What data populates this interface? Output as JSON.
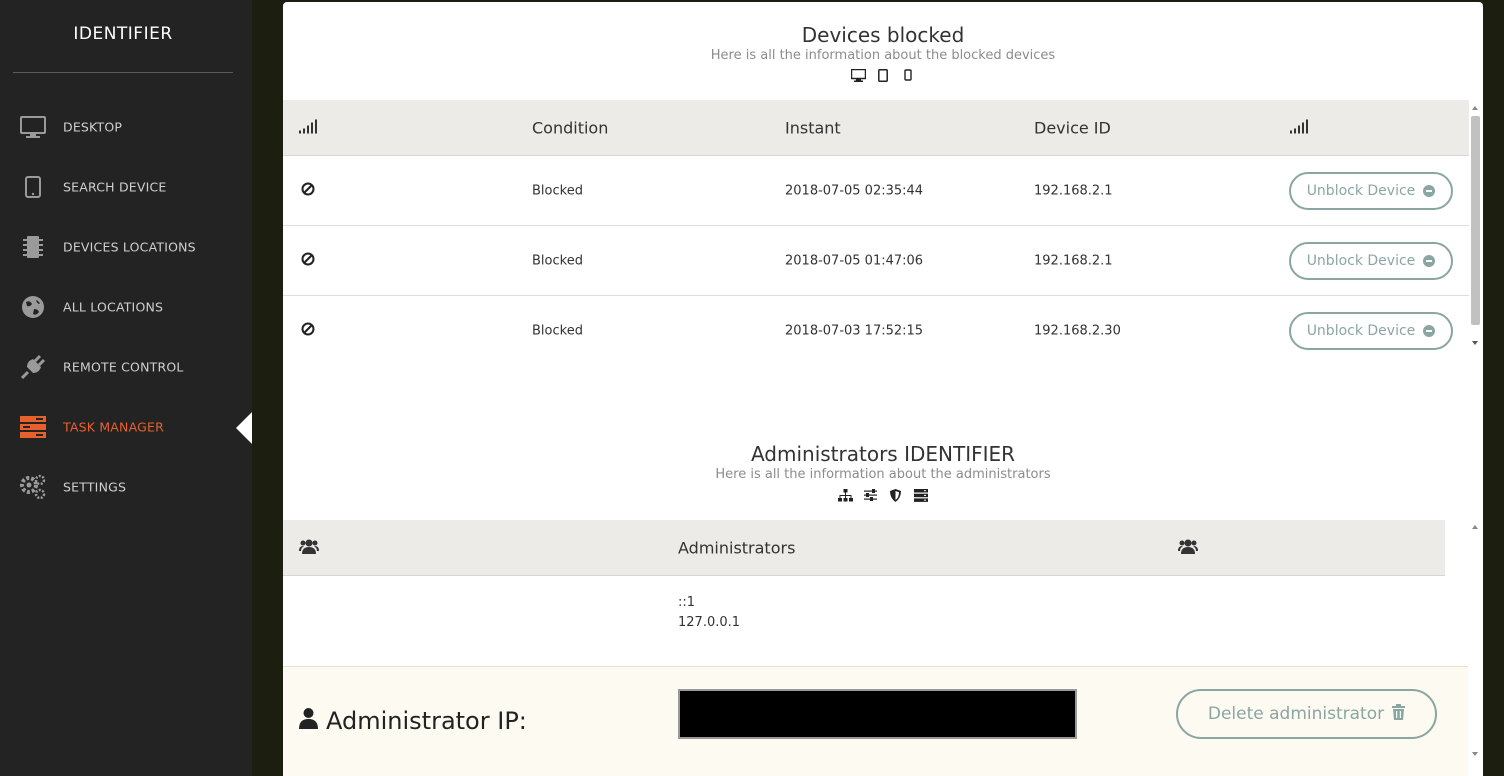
{
  "app": {
    "brand": "IDENTIFIER"
  },
  "sidebar": {
    "items": [
      {
        "label": "DESKTOP",
        "icon": "monitor-icon"
      },
      {
        "label": "SEARCH DEVICE",
        "icon": "tablet-icon"
      },
      {
        "label": "DEVICES LOCATIONS",
        "icon": "chip-icon"
      },
      {
        "label": "ALL LOCATIONS",
        "icon": "globe-icon"
      },
      {
        "label": "REMOTE CONTROL",
        "icon": "plug-icon"
      },
      {
        "label": "TASK MANAGER",
        "icon": "tasks-icon",
        "active": true
      },
      {
        "label": "SETTINGS",
        "icon": "gears-icon"
      }
    ],
    "active_color": "#e8602c"
  },
  "blocked": {
    "title": "Devices blocked",
    "subtitle": "Here is all the information about the blocked devices",
    "icons": [
      "desktop-icon",
      "tablet-icon",
      "mobile-icon"
    ],
    "headers": {
      "signal": "signal-icon",
      "condition": "Condition",
      "instant": "Instant",
      "device_id": "Device ID",
      "signal_end": "signal-icon"
    },
    "rows": [
      {
        "condition": "Blocked",
        "instant": "2018-07-05 02:35:44",
        "device_id": "192.168.2.1",
        "action": "Unblock Device"
      },
      {
        "condition": "Blocked",
        "instant": "2018-07-05 01:47:06",
        "device_id": "192.168.2.1",
        "action": "Unblock Device"
      },
      {
        "condition": "Blocked",
        "instant": "2018-07-03 17:52:15",
        "device_id": "192.168.2.30",
        "action": "Unblock Device"
      }
    ]
  },
  "admins": {
    "title": "Administrators IDENTIFIER",
    "subtitle": "Here is all the information about the administrators",
    "icons": [
      "sitemap-icon",
      "sliders-icon",
      "shield-icon",
      "server-icon"
    ],
    "header": "Administrators",
    "list": [
      "::1",
      "127.0.0.1"
    ],
    "form": {
      "label": "Administrator IP:",
      "input_value": "",
      "delete_label": "Delete administrator"
    }
  },
  "colors": {
    "accent": "#8aa6a3",
    "sidebar_bg": "#232323",
    "header_bg": "#edebe7"
  }
}
